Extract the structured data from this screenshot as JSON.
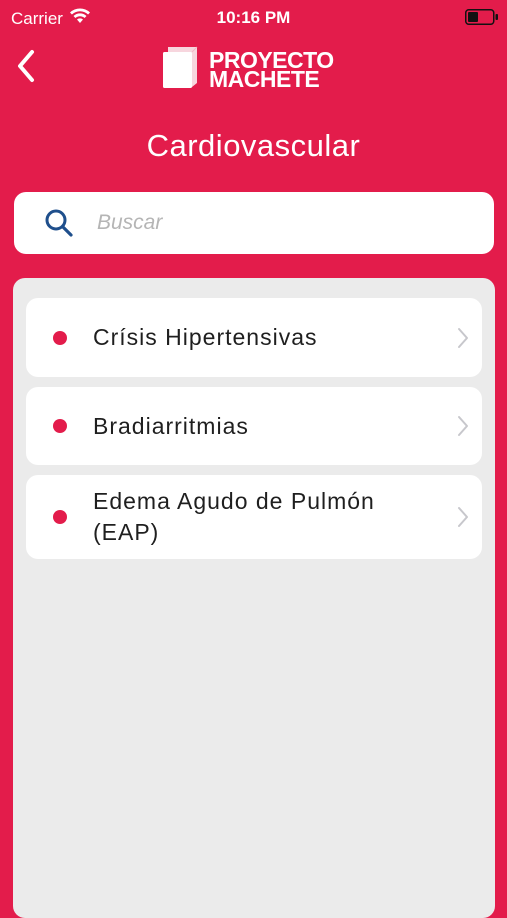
{
  "status_bar": {
    "carrier": "Carrier",
    "time": "10:16 PM",
    "wifi_icon": "wifi-icon",
    "battery_icon": "battery-icon"
  },
  "header": {
    "back_icon": "chevron-left-icon",
    "logo_line1": "PROYECTO",
    "logo_line2": "MACHETE",
    "title": "Cardiovascular"
  },
  "search": {
    "placeholder": "Buscar",
    "value": "",
    "icon": "search-icon"
  },
  "list": {
    "items": [
      {
        "label": "Crísis Hipertensivas"
      },
      {
        "label": "Bradiarritmias"
      },
      {
        "label": "Edema Agudo de Pulmón (EAP)"
      }
    ]
  },
  "colors": {
    "accent": "#e31c4b",
    "panel": "#ebebeb",
    "card": "#ffffff",
    "search_icon": "#1f4f8c"
  }
}
